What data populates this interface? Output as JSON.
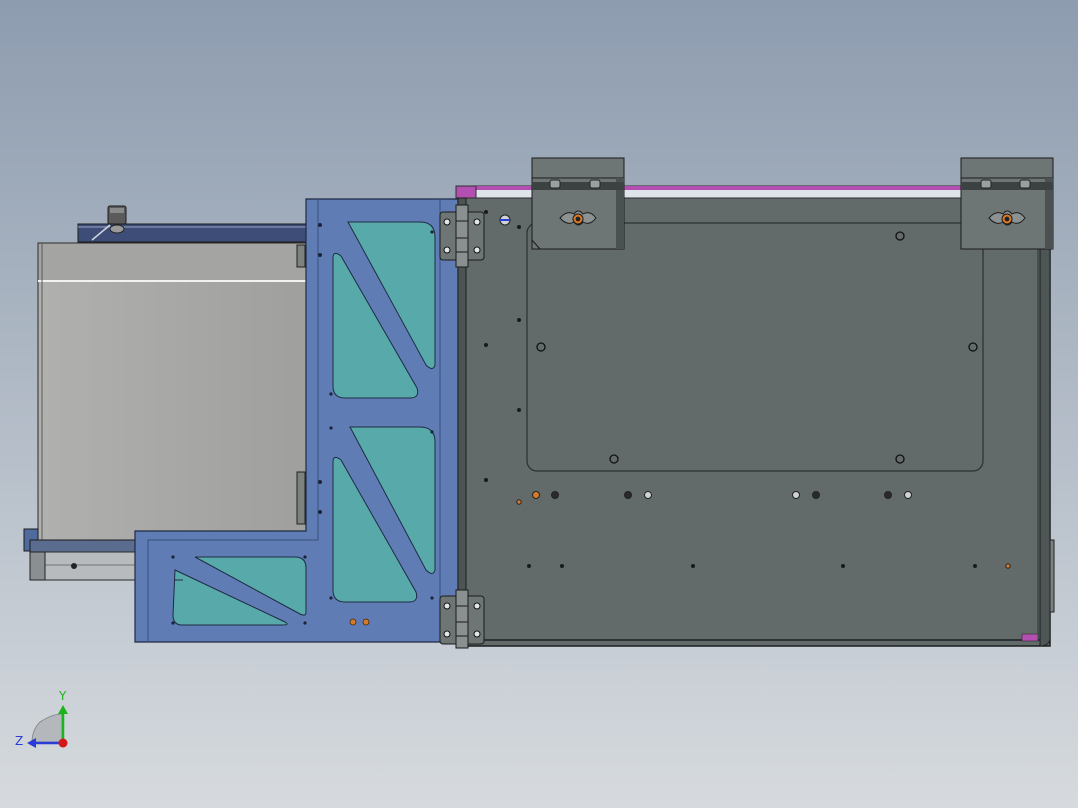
{
  "viewport": {
    "background_top": "#8d9caf",
    "background_bottom": "#d6dade"
  },
  "triad": {
    "y_label": "Y",
    "z_label": "Z",
    "y_color": "#1db31d",
    "z_color": "#2a3bd6",
    "x_color": "#d41818"
  },
  "colors": {
    "frame_blue": "#5f7db4",
    "frame_blue_dark": "#3b4f80",
    "glass_teal": "#58aaaa",
    "main_plate": "#626b6a",
    "main_plate_dark": "#3b4140",
    "panel_gray": "#a9a9a8",
    "hinge_gray": "#6e7575",
    "rail_magenta": "#b24fb0",
    "accent_orange": "#d87a2a"
  }
}
